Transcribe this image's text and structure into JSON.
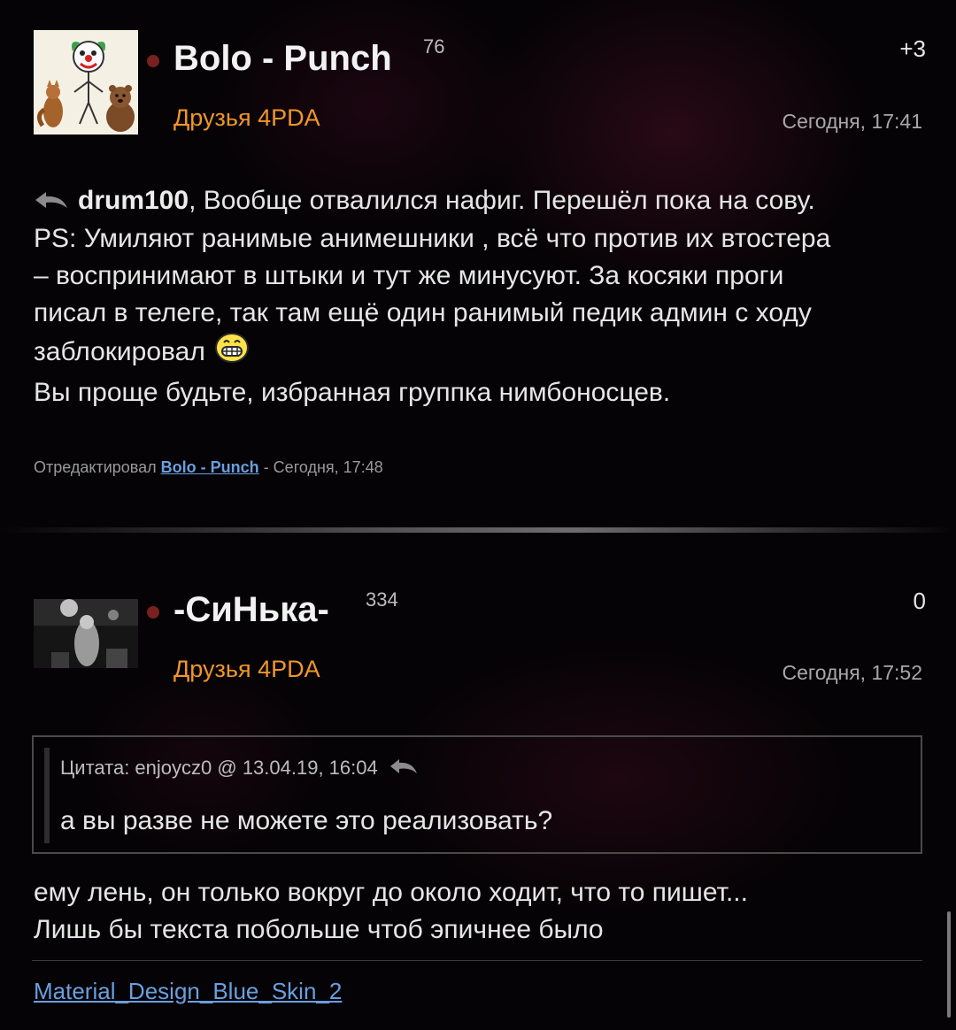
{
  "posts": [
    {
      "author": "Bolo - Punch",
      "reputation": "76",
      "score": "+3",
      "group": "Друзья 4PDA",
      "time": "Сегодня, 17:41",
      "reply_to": "drum100",
      "lines": [
        ", Вообще отвалился нафиг. Перешёл пока на сову.",
        "PS: Умиляют ранимые анимешники , всё что против их втостера",
        "– воспринимают в штыки и тут же минусуют. За косяки проги",
        "писал в телеге, так там ещё один ранимый педик админ с ходу",
        "заблокировал",
        "Вы проще будьте, избранная группка нимбоносцев."
      ],
      "edited": {
        "prefix": "Отредактировал",
        "editor": "Bolo - Punch",
        "suffix": "- Сегодня, 17:48"
      }
    },
    {
      "author": "-СиНька-",
      "reputation": "334",
      "score": "0",
      "group": "Друзья 4PDA",
      "time": "Сегодня, 17:52",
      "quote": {
        "header": "Цитата: enjoycz0 @ 13.04.19, 16:04",
        "text": "а вы разве не можете это реализовать?"
      },
      "lines": [
        "ему лень, он только вокруг до около ходит, что то пишет...",
        "Лишь бы текста побольше чтоб эпичнее было"
      ]
    }
  ],
  "footer": {
    "skin_link": "Material_Design_Blue_Skin_2"
  },
  "colors": {
    "group": "#f0962a",
    "link": "#6a9fe0",
    "online_dot": "#7a2020"
  },
  "icons": {
    "reply": "reply-arrow-icon",
    "smile": "grin-smiley-icon",
    "quote_reply": "quote-reply-arrow-icon"
  }
}
